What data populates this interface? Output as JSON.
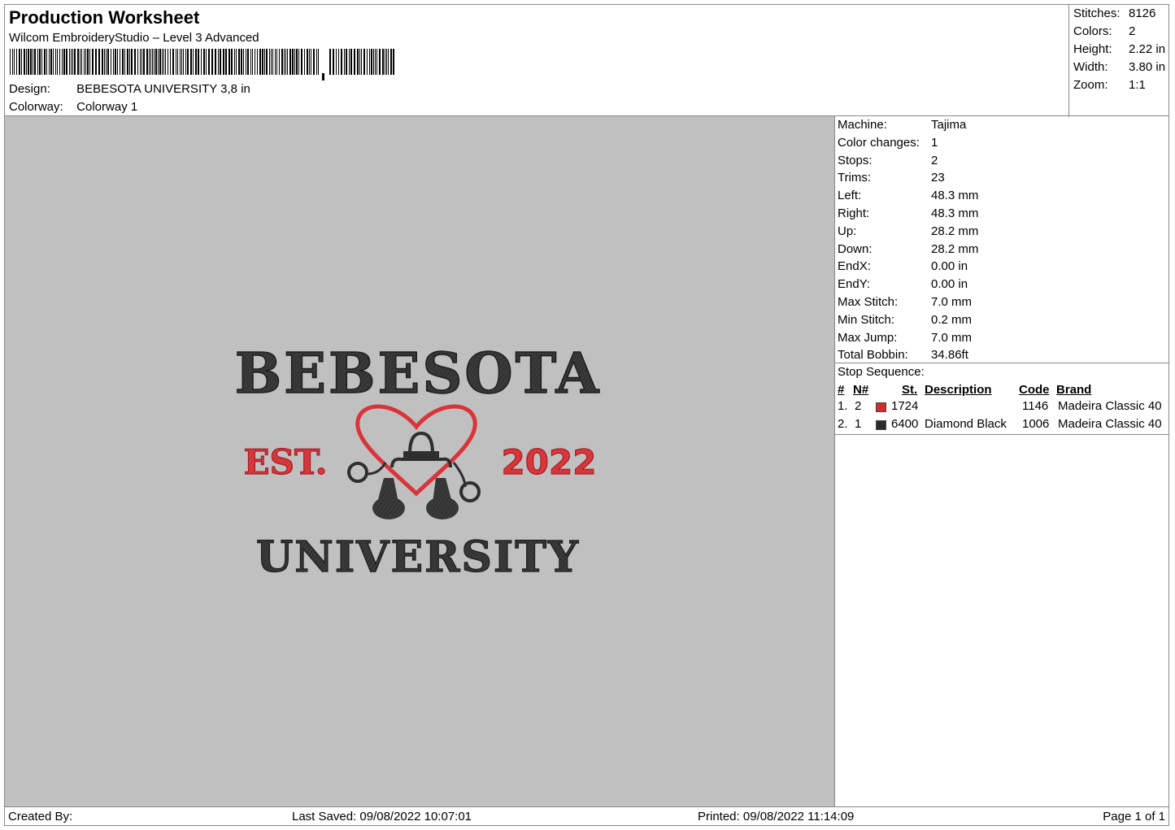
{
  "header": {
    "title": "Production Worksheet",
    "subtitle": "Wilcom EmbroideryStudio – Level 3 Advanced",
    "design_label": "Design:",
    "design_value": "BEBESOTA UNIVERSITY 3,8 in",
    "colorway_label": "Colorway:",
    "colorway_value": "Colorway 1"
  },
  "summary": {
    "stitches_label": "Stitches:",
    "stitches": "8126",
    "colors_label": "Colors:",
    "colors": "2",
    "height_label": "Height:",
    "height": "2.22 in",
    "width_label": "Width:",
    "width": "3.80 in",
    "zoom_label": "Zoom:",
    "zoom": "1:1"
  },
  "details": [
    {
      "label": "Machine:",
      "value": "Tajima"
    },
    {
      "label": "Color changes:",
      "value": "1"
    },
    {
      "label": "Stops:",
      "value": "2"
    },
    {
      "label": "Trims:",
      "value": "23"
    },
    {
      "label": "Left:",
      "value": "48.3 mm"
    },
    {
      "label": "Right:",
      "value": "48.3 mm"
    },
    {
      "label": "Up:",
      "value": "28.2 mm"
    },
    {
      "label": "Down:",
      "value": "28.2 mm"
    },
    {
      "label": "EndX:",
      "value": "0.00 in"
    },
    {
      "label": "EndY:",
      "value": "0.00 in"
    },
    {
      "label": "Max Stitch:",
      "value": "7.0 mm"
    },
    {
      "label": "Min Stitch:",
      "value": "0.2 mm"
    },
    {
      "label": "Max Jump:",
      "value": "7.0 mm"
    },
    {
      "label": "Total Bobbin:",
      "value": "34.86ft"
    }
  ],
  "stop_sequence": {
    "title": "Stop Sequence:",
    "headers": {
      "num": "#",
      "n": "N#",
      "st": "St.",
      "description": "Description",
      "code": "Code",
      "brand": "Brand"
    },
    "rows": [
      {
        "num": "1.",
        "n": "2",
        "color": "#d42b2b",
        "st": "1724",
        "description": "",
        "code": "1146",
        "brand": "Madeira Classic 40"
      },
      {
        "num": "2.",
        "n": "1",
        "color": "#2b2b2b",
        "st": "6400",
        "description": "Diamond Black",
        "code": "1006",
        "brand": "Madeira Classic 40"
      }
    ]
  },
  "design": {
    "line1": "BEBESOTA",
    "left_text": "EST.",
    "right_text": "2022",
    "line2": "UNIVERSITY",
    "thread_dark": "#383838",
    "thread_red": "#d9343a",
    "background": "#c0c0c0"
  },
  "footer": {
    "created_by": "Created By:",
    "last_saved": "Last Saved: 09/08/2022 10:07:01",
    "printed": "Printed: 09/08/2022 11:14:09",
    "page": "Page 1 of 1"
  }
}
